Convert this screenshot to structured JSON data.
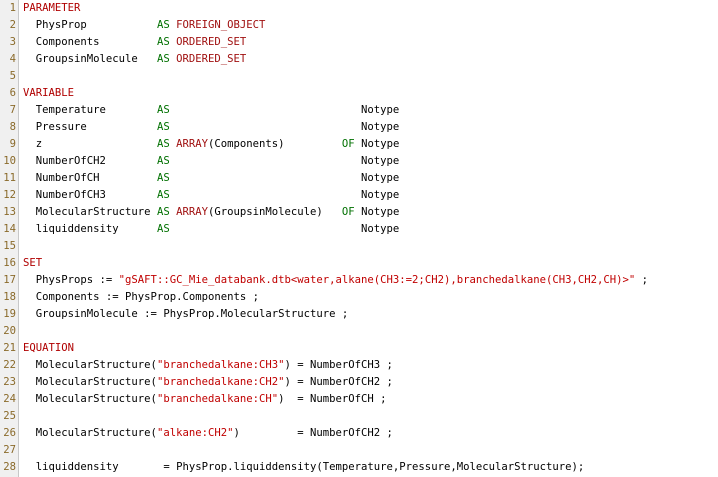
{
  "editor": {
    "lines": [
      {
        "n": "1",
        "t": [
          [
            "kw",
            "PARAMETER"
          ]
        ]
      },
      {
        "n": "2",
        "t": [
          [
            "plain",
            "  PhysProp           "
          ],
          [
            "op",
            "AS"
          ],
          [
            "plain",
            " "
          ],
          [
            "tp",
            "FOREIGN_OBJECT"
          ]
        ]
      },
      {
        "n": "3",
        "t": [
          [
            "plain",
            "  Components         "
          ],
          [
            "op",
            "AS"
          ],
          [
            "plain",
            " "
          ],
          [
            "tp",
            "ORDERED_SET"
          ]
        ]
      },
      {
        "n": "4",
        "t": [
          [
            "plain",
            "  GroupsinMolecule   "
          ],
          [
            "op",
            "AS"
          ],
          [
            "plain",
            " "
          ],
          [
            "tp",
            "ORDERED_SET"
          ]
        ]
      },
      {
        "n": "5",
        "t": []
      },
      {
        "n": "6",
        "t": [
          [
            "kw",
            "VARIABLE"
          ]
        ]
      },
      {
        "n": "7",
        "t": [
          [
            "plain",
            "  Temperature        "
          ],
          [
            "op",
            "AS"
          ],
          [
            "plain",
            "                              Notype"
          ]
        ]
      },
      {
        "n": "8",
        "t": [
          [
            "plain",
            "  Pressure           "
          ],
          [
            "op",
            "AS"
          ],
          [
            "plain",
            "                              Notype"
          ]
        ]
      },
      {
        "n": "9",
        "t": [
          [
            "plain",
            "  z                  "
          ],
          [
            "op",
            "AS"
          ],
          [
            "plain",
            " "
          ],
          [
            "tp",
            "ARRAY"
          ],
          [
            "plain",
            "(Components)         "
          ],
          [
            "op",
            "OF"
          ],
          [
            "plain",
            " Notype"
          ]
        ]
      },
      {
        "n": "10",
        "t": [
          [
            "plain",
            "  NumberOfCH2        "
          ],
          [
            "op",
            "AS"
          ],
          [
            "plain",
            "                              Notype"
          ]
        ]
      },
      {
        "n": "11",
        "t": [
          [
            "plain",
            "  NumberOfCH         "
          ],
          [
            "op",
            "AS"
          ],
          [
            "plain",
            "                              Notype"
          ]
        ]
      },
      {
        "n": "12",
        "t": [
          [
            "plain",
            "  NumberOfCH3        "
          ],
          [
            "op",
            "AS"
          ],
          [
            "plain",
            "                              Notype"
          ]
        ]
      },
      {
        "n": "13",
        "t": [
          [
            "plain",
            "  MolecularStructure "
          ],
          [
            "op",
            "AS"
          ],
          [
            "plain",
            " "
          ],
          [
            "tp",
            "ARRAY"
          ],
          [
            "plain",
            "(GroupsinMolecule)   "
          ],
          [
            "op",
            "OF"
          ],
          [
            "plain",
            " Notype"
          ]
        ]
      },
      {
        "n": "14",
        "t": [
          [
            "plain",
            "  liquiddensity      "
          ],
          [
            "op",
            "AS"
          ],
          [
            "plain",
            "                              Notype"
          ]
        ]
      },
      {
        "n": "15",
        "t": []
      },
      {
        "n": "16",
        "t": [
          [
            "kw",
            "SET"
          ]
        ]
      },
      {
        "n": "17",
        "t": [
          [
            "plain",
            "  PhysProps := "
          ],
          [
            "str",
            "\"gSAFT::GC_Mie_databank.dtb<water,alkane(CH3:=2;CH2),branchedalkane(CH3,CH2,CH)>\""
          ],
          [
            "plain",
            " ;"
          ]
        ]
      },
      {
        "n": "18",
        "t": [
          [
            "plain",
            "  Components := PhysProp.Components ;"
          ]
        ]
      },
      {
        "n": "19",
        "t": [
          [
            "plain",
            "  GroupsinMolecule := PhysProp.MolecularStructure ;"
          ]
        ]
      },
      {
        "n": "20",
        "t": []
      },
      {
        "n": "21",
        "t": [
          [
            "kw",
            "EQUATION"
          ]
        ]
      },
      {
        "n": "22",
        "t": [
          [
            "plain",
            "  MolecularStructure("
          ],
          [
            "str",
            "\"branchedalkane:CH3\""
          ],
          [
            "plain",
            ") = NumberOfCH3 ;"
          ]
        ]
      },
      {
        "n": "23",
        "t": [
          [
            "plain",
            "  MolecularStructure("
          ],
          [
            "str",
            "\"branchedalkane:CH2\""
          ],
          [
            "plain",
            ") = NumberOfCH2 ;"
          ]
        ]
      },
      {
        "n": "24",
        "t": [
          [
            "plain",
            "  MolecularStructure("
          ],
          [
            "str",
            "\"branchedalkane:CH\""
          ],
          [
            "plain",
            ")  = NumberOfCH ;"
          ]
        ]
      },
      {
        "n": "25",
        "t": []
      },
      {
        "n": "26",
        "t": [
          [
            "plain",
            "  MolecularStructure("
          ],
          [
            "str",
            "\"alkane:CH2\""
          ],
          [
            "plain",
            ")         = NumberOfCH2 ;"
          ]
        ]
      },
      {
        "n": "27",
        "t": []
      },
      {
        "n": "28",
        "t": [
          [
            "plain",
            "  liquiddensity       = PhysProp.liquiddensity(Temperature,Pressure,MolecularStructure);"
          ]
        ]
      }
    ]
  }
}
